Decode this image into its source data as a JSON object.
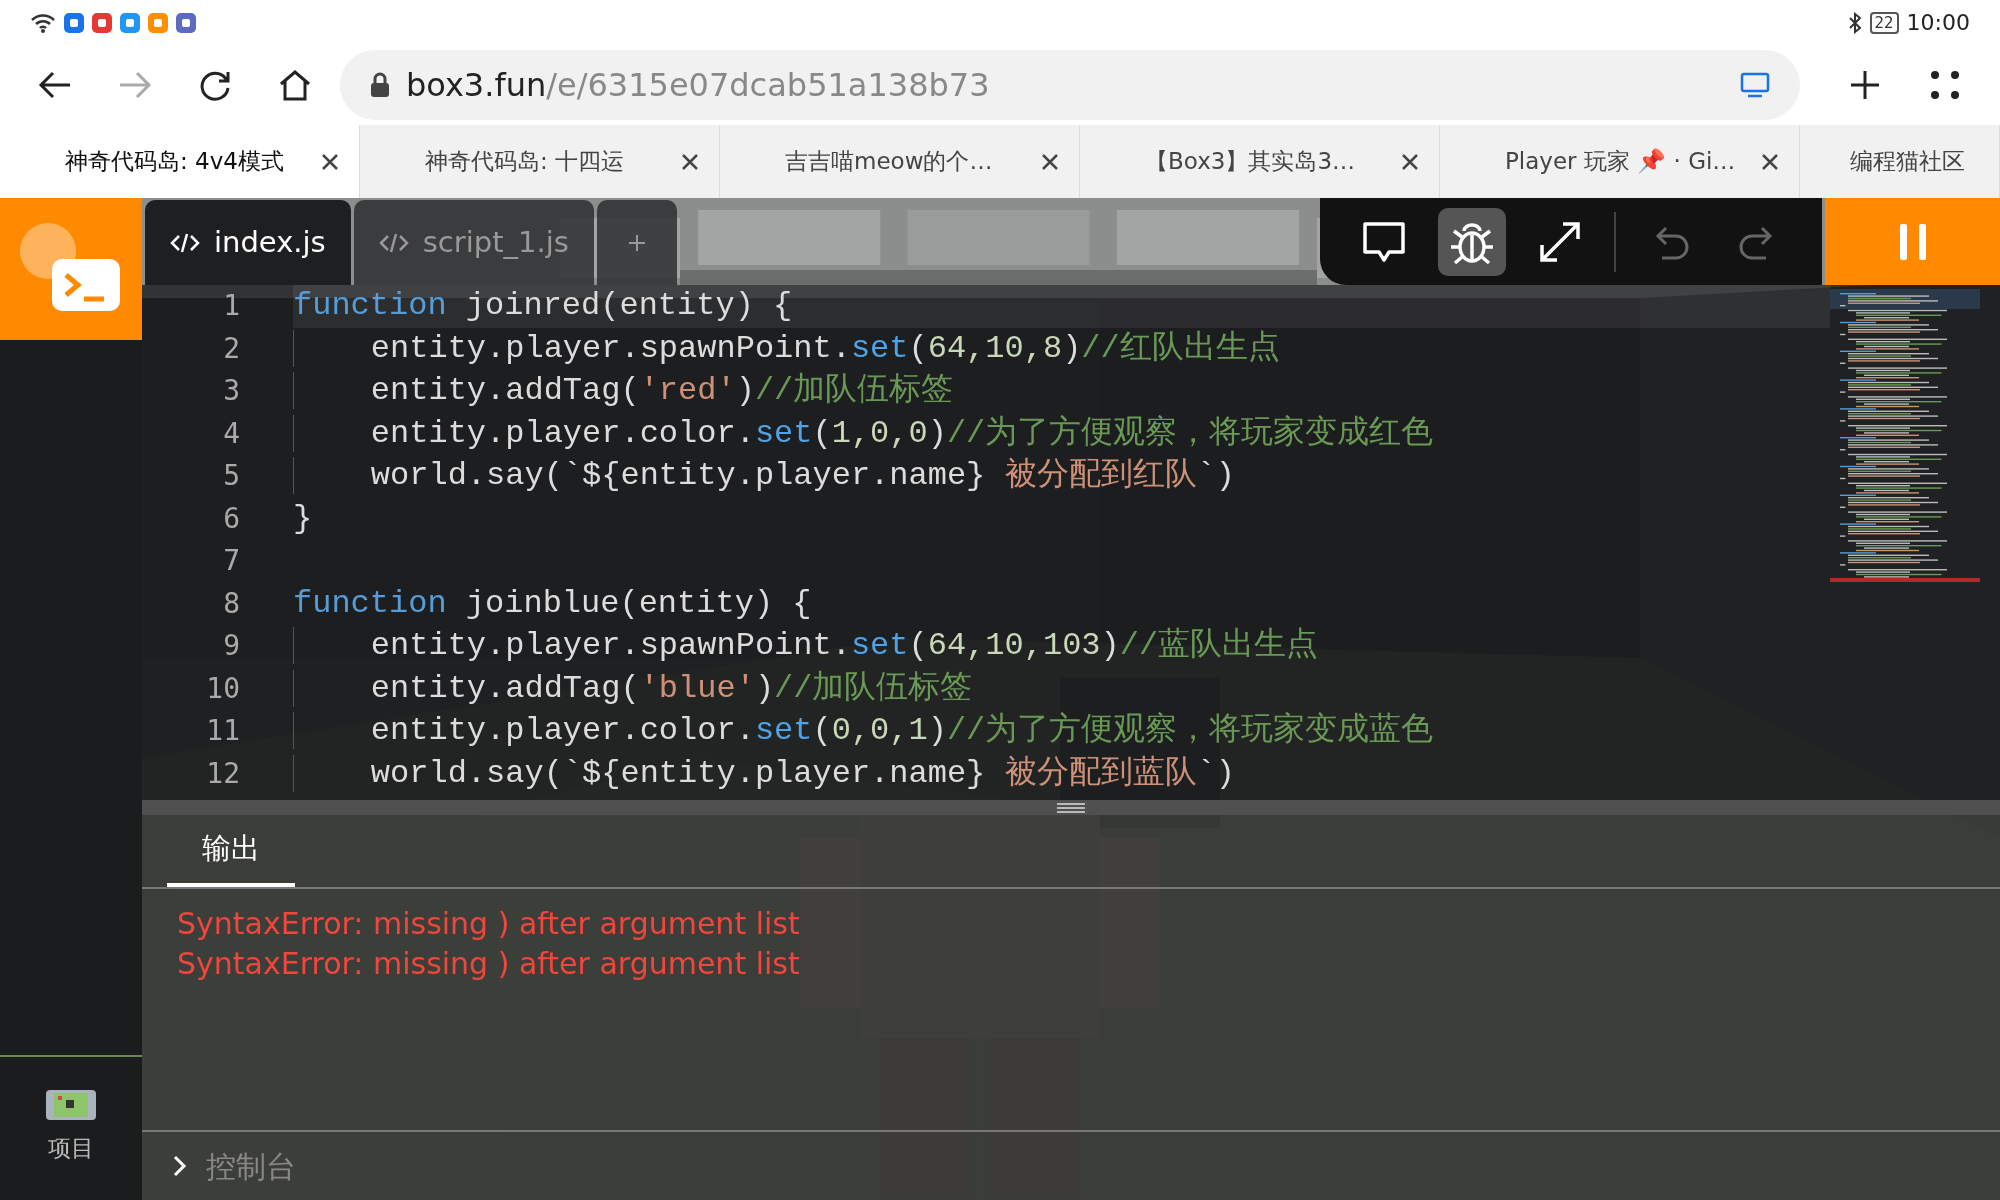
{
  "status_bar": {
    "battery": "22",
    "time": "10:00"
  },
  "browser": {
    "url_host": "box3.fun",
    "url_path": "/e/6315e07dcab51a138b73",
    "forward_disabled": true
  },
  "browser_tabs": [
    {
      "title": "神奇代码岛: 4v4模式",
      "selected": true,
      "closable": true
    },
    {
      "title": "神奇代码岛: 十四运",
      "selected": false,
      "closable": true
    },
    {
      "title": "吉吉喵meow的个…",
      "selected": false,
      "closable": true
    },
    {
      "title": "【Box3】其实岛3…",
      "selected": false,
      "closable": true
    },
    {
      "title": "Player 玩家 📌 · Gi…",
      "selected": false,
      "closable": true
    },
    {
      "title": "编程猫社区",
      "selected": false,
      "closable": false
    }
  ],
  "editor_tabs": [
    {
      "label": "index.js",
      "selected": true
    },
    {
      "label": "script_1.js",
      "selected": false
    }
  ],
  "toolbar": [
    {
      "kind": "chat",
      "selected": false,
      "disabled": false
    },
    {
      "kind": "debug",
      "selected": true,
      "disabled": false
    },
    {
      "kind": "resize",
      "selected": false,
      "disabled": false
    },
    {
      "kind": "undo",
      "selected": false,
      "disabled": true
    },
    {
      "kind": "redo",
      "selected": false,
      "disabled": true
    },
    {
      "kind": "pause"
    }
  ],
  "code": {
    "lines": [
      {
        "number": "1",
        "current": true,
        "tokens": [
          {
            "kind": "keyword",
            "text": "function"
          },
          {
            "kind": "plain",
            "text": " joinred(entity) {"
          }
        ]
      },
      {
        "number": "2",
        "current": false,
        "tokens": [
          {
            "kind": "plain",
            "text": "    entity.player.spawnPoint."
          },
          {
            "kind": "method",
            "text": "set"
          },
          {
            "kind": "plain",
            "text": "("
          },
          {
            "kind": "number",
            "text": "64,10,8"
          },
          {
            "kind": "plain",
            "text": ")"
          },
          {
            "kind": "comment",
            "text": "//红队出生点"
          }
        ]
      },
      {
        "number": "3",
        "current": false,
        "tokens": [
          {
            "kind": "plain",
            "text": "    entity.addTag("
          },
          {
            "kind": "string",
            "text": "'red'"
          },
          {
            "kind": "plain",
            "text": ")"
          },
          {
            "kind": "comment",
            "text": "//加队伍标签"
          }
        ]
      },
      {
        "number": "4",
        "current": false,
        "tokens": [
          {
            "kind": "plain",
            "text": "    entity.player.color."
          },
          {
            "kind": "method",
            "text": "set"
          },
          {
            "kind": "plain",
            "text": "("
          },
          {
            "kind": "number",
            "text": "1,0,0"
          },
          {
            "kind": "plain",
            "text": ")"
          },
          {
            "kind": "comment",
            "text": "//为了方便观察，将玩家变成红色"
          }
        ]
      },
      {
        "number": "5",
        "current": false,
        "tokens": [
          {
            "kind": "plain",
            "text": "    world.say(`${entity.player.name}"
          },
          {
            "kind": "string",
            "text": " 被分配到红队"
          },
          {
            "kind": "plain",
            "text": "`)"
          }
        ]
      },
      {
        "number": "6",
        "current": false,
        "tokens": [
          {
            "kind": "plain",
            "text": "}"
          }
        ]
      },
      {
        "number": "7",
        "current": false
      },
      {
        "number": "8",
        "current": false,
        "tokens": [
          {
            "kind": "keyword",
            "text": "function"
          },
          {
            "kind": "plain",
            "text": " joinblue(entity) {"
          }
        ]
      },
      {
        "number": "9",
        "current": false,
        "tokens": [
          {
            "kind": "plain",
            "text": "    entity.player.spawnPoint."
          },
          {
            "kind": "method",
            "text": "set"
          },
          {
            "kind": "plain",
            "text": "("
          },
          {
            "kind": "number",
            "text": "64,10,103"
          },
          {
            "kind": "plain",
            "text": ")"
          },
          {
            "kind": "comment",
            "text": "//蓝队出生点"
          }
        ]
      },
      {
        "number": "10",
        "current": false,
        "tokens": [
          {
            "kind": "plain",
            "text": "    entity.addTag("
          },
          {
            "kind": "string",
            "text": "'blue'"
          },
          {
            "kind": "plain",
            "text": ")"
          },
          {
            "kind": "comment",
            "text": "//加队伍标签"
          }
        ]
      },
      {
        "number": "11",
        "current": false,
        "tokens": [
          {
            "kind": "plain",
            "text": "    entity.player.color."
          },
          {
            "kind": "method",
            "text": "set"
          },
          {
            "kind": "plain",
            "text": "("
          },
          {
            "kind": "number",
            "text": "0,0,1"
          },
          {
            "kind": "plain",
            "text": ")"
          },
          {
            "kind": "comment",
            "text": "//为了方便观察，将玩家变成蓝色"
          }
        ]
      },
      {
        "number": "12",
        "current": false,
        "tokens": [
          {
            "kind": "plain",
            "text": "    world.say(`${entity.player.name}"
          },
          {
            "kind": "string",
            "text": " 被分配到蓝队"
          },
          {
            "kind": "plain",
            "text": "`)"
          }
        ]
      }
    ]
  },
  "output": {
    "tabs": [
      {
        "label": "输出",
        "selected": true
      }
    ],
    "errors": [
      "SyntaxError: missing ) after argument list",
      "SyntaxError: missing ) after argument list"
    ]
  },
  "console": {
    "label": "控制台",
    "expanded": false
  },
  "sidebar": {
    "items": [
      {
        "label": "项目"
      }
    ]
  }
}
